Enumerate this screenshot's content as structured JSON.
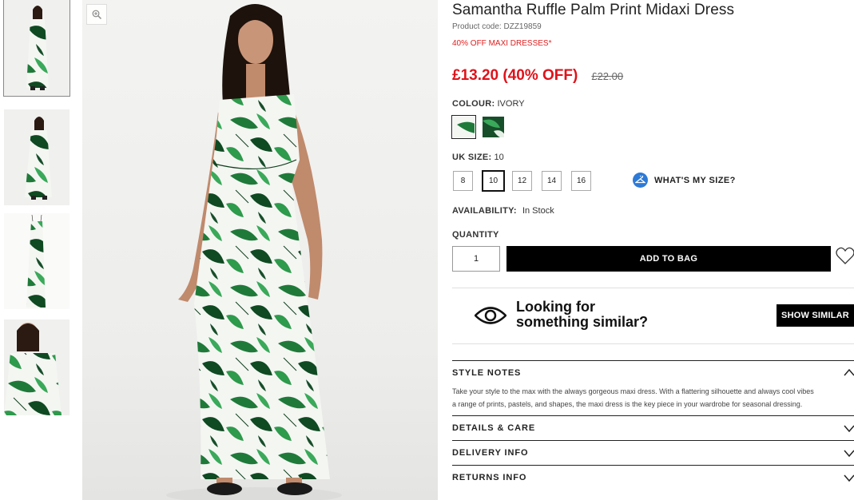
{
  "product": {
    "title": "Samantha Ruffle Palm Print Midaxi Dress",
    "code": "Product code: DZZ19859",
    "promo": "40% OFF MAXI DRESSES*",
    "price_now": "£13.20 (40% OFF)",
    "price_was": "£22.00"
  },
  "colour": {
    "label": "COLOUR:",
    "value": "IVORY",
    "swatches": [
      "ivory-palm",
      "green-palm"
    ]
  },
  "size": {
    "label": "UK SIZE:",
    "value": "10",
    "options": [
      "8",
      "10",
      "12",
      "14",
      "16"
    ],
    "selected": "10",
    "whats_my_size": "WHAT'S MY SIZE?"
  },
  "availability": {
    "label": "AVAILABILITY:",
    "value": "In Stock"
  },
  "quantity": {
    "label": "QUANTITY",
    "value": "1"
  },
  "actions": {
    "add_to_bag": "ADD TO BAG",
    "show_similar": "SHOW SIMILAR"
  },
  "similar": {
    "line1": "Looking for",
    "line2": "something similar?"
  },
  "accordion": {
    "style_notes": {
      "title": "STYLE NOTES",
      "line1": "Take your style to the max with the always gorgeous maxi dress. With a flattering silhouette and always cool vibes",
      "line2": "a range of prints, pastels, and shapes, the maxi dress is the key piece in your wardrobe for seasonal dressing."
    },
    "details_care": "DETAILS & CARE",
    "delivery_info": "DELIVERY INFO",
    "returns_info": "RETURNS INFO"
  },
  "colors": {
    "price_red": "#e0121a",
    "promo_red": "#e02020",
    "accent_blue": "#2d7ad6",
    "leaf_green": "#1f7a3a",
    "dark_green": "#0f4a22"
  },
  "icons": [
    "zoom-icon",
    "hanger-icon",
    "heart-icon",
    "eye-icon",
    "chevron-up-icon",
    "chevron-down-icon"
  ]
}
